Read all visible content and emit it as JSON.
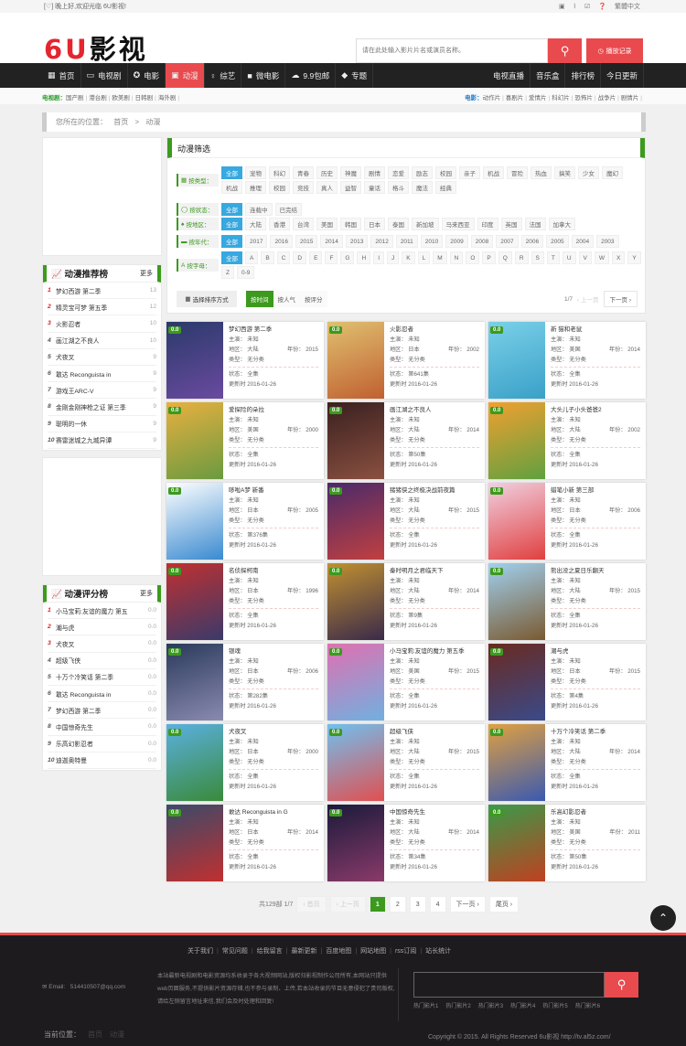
{
  "topbar": {
    "welcome": "[♡] 晚上好,欢迎光临 6U影视!",
    "tools": [
      "▣",
      "⌇",
      "☑",
      "❓"
    ],
    "lang": "繁體中文"
  },
  "logo": {
    "red": "6U",
    "black": "影视"
  },
  "search": {
    "placeholder": "请在此处输入影片片名或演员名称。",
    "button_icon": "search-icon"
  },
  "history_label": "播放记录",
  "nav": {
    "left": [
      {
        "icon": "▦",
        "label": "首页"
      },
      {
        "icon": "▭",
        "label": "电视剧"
      },
      {
        "icon": "✪",
        "label": "电影"
      },
      {
        "icon": "▣",
        "label": "动漫",
        "active": true
      },
      {
        "icon": "♀",
        "label": "综艺"
      },
      {
        "icon": "■",
        "label": "微电影"
      },
      {
        "icon": "☁",
        "label": "9.9包邮"
      },
      {
        "icon": "◆",
        "label": "专题"
      }
    ],
    "right": [
      "电视直播",
      "音乐盒",
      "排行榜",
      "今日更新"
    ]
  },
  "subnav": {
    "left_label": "电视剧：",
    "left_items": [
      "国产剧",
      "港台剧",
      "欧美剧",
      "日韩剧",
      "海外剧"
    ],
    "right_label": "电影：",
    "right_items": [
      "动作片",
      "喜剧片",
      "爱情片",
      "科幻片",
      "恐怖片",
      "战争片",
      "剧情片"
    ]
  },
  "breadcrumb": {
    "label": "您所在的位置：",
    "home": "首页",
    "sep": ">",
    "current": "动漫"
  },
  "recommend": {
    "title": "动漫推荐榜",
    "more": "更多",
    "items": [
      {
        "n": "1",
        "name": "梦幻西游 第二季",
        "v": "13"
      },
      {
        "n": "2",
        "name": "精灵宝可梦 第五季",
        "v": "12"
      },
      {
        "n": "3",
        "name": "火影忍者",
        "v": "10"
      },
      {
        "n": "4",
        "name": "画江湖之不良人",
        "v": "10"
      },
      {
        "n": "5",
        "name": "犬夜叉",
        "v": "9"
      },
      {
        "n": "6",
        "name": "敢达 Reconguista in",
        "v": "9"
      },
      {
        "n": "7",
        "name": "游戏王ARC-V",
        "v": "9"
      },
      {
        "n": "8",
        "name": "金刚金刚神枪之证 第三季",
        "v": "9"
      },
      {
        "n": "9",
        "name": "聪明的一休",
        "v": "9"
      },
      {
        "n": "10",
        "name": "赛雷迷城之九城异谭",
        "v": "9"
      }
    ]
  },
  "score": {
    "title": "动漫评分榜",
    "more": "更多",
    "items": [
      {
        "n": "1",
        "name": "小马宝莉:友谊的魔力 第五",
        "v": "0.0"
      },
      {
        "n": "2",
        "name": "潮与虎",
        "v": "0.0"
      },
      {
        "n": "3",
        "name": "犬夜叉",
        "v": "0.0"
      },
      {
        "n": "4",
        "name": "超级飞侠",
        "v": "0.0"
      },
      {
        "n": "5",
        "name": "十万个冷笑话 第二季",
        "v": "0.0"
      },
      {
        "n": "6",
        "name": "敢达 Reconguista in",
        "v": "0.0"
      },
      {
        "n": "7",
        "name": "梦幻西游 第二季",
        "v": "0.0"
      },
      {
        "n": "8",
        "name": "中国惊奇先生",
        "v": "0.0"
      },
      {
        "n": "9",
        "name": "乐高幻影忍者",
        "v": "0.0"
      },
      {
        "n": "10",
        "name": "迪迦奥特曼",
        "v": "0.0"
      }
    ]
  },
  "filter": {
    "title": "动漫筛选",
    "rows": [
      {
        "icon": "▦",
        "label": "按类型：",
        "opts": [
          "全部",
          "宠物",
          "科幻",
          "青春",
          "历史",
          "神魔",
          "剧情",
          "恋爱",
          "励志",
          "校园",
          "亲子",
          "机战",
          "冒险",
          "热血",
          "搞笑",
          "少女",
          "魔幻",
          "机战",
          "推理",
          "校园",
          "竞技",
          "真人",
          "益智",
          "童话",
          "格斗",
          "魔法",
          "经典"
        ]
      },
      {
        "icon": "◯",
        "label": "按状态：",
        "opts": [
          "全部",
          "连载中",
          "已完结"
        ]
      },
      {
        "icon": "♠",
        "label": "按地区：",
        "opts": [
          "全部",
          "大陆",
          "香港",
          "台湾",
          "美国",
          "韩国",
          "日本",
          "泰国",
          "新加坡",
          "马来西亚",
          "印度",
          "英国",
          "法国",
          "加拿大"
        ]
      },
      {
        "icon": "▬",
        "label": "按年代：",
        "opts": [
          "全部",
          "2017",
          "2016",
          "2015",
          "2014",
          "2013",
          "2012",
          "2011",
          "2010",
          "2009",
          "2008",
          "2007",
          "2006",
          "2005",
          "2004",
          "2003"
        ]
      },
      {
        "icon": "A",
        "label": "按字母：",
        "opts": [
          "全部",
          "A",
          "B",
          "C",
          "D",
          "E",
          "F",
          "G",
          "H",
          "I",
          "J",
          "K",
          "L",
          "M",
          "N",
          "O",
          "P",
          "Q",
          "R",
          "S",
          "T",
          "U",
          "V",
          "W",
          "X",
          "Y",
          "Z",
          "0-9"
        ]
      }
    ],
    "sort_label": "选择排序方式",
    "sort_opts": [
      "按时间",
      "按人气",
      "按评分"
    ],
    "page": "1/7",
    "prev": "‹ 上一页",
    "next": "下一页 ›"
  },
  "labels": {
    "actor": "主演：",
    "area": "地区：",
    "year": "年份：",
    "type": "类型：",
    "status": "状态：",
    "updated": "更新时"
  },
  "cards": [
    {
      "title": "梦幻西游 第二季",
      "score": "0.0",
      "actor": "未知",
      "area": "大陆",
      "year": "2015",
      "type": "无分类",
      "status": "全集",
      "date": "2016-01-26",
      "c1": "#2a3a6a",
      "c2": "#6a4aa0"
    },
    {
      "title": "火影忍者",
      "score": "0.0",
      "actor": "未知",
      "area": "日本",
      "year": "2002",
      "type": "无分类",
      "status": "第641集",
      "date": "2016-01-26",
      "c1": "#e0c070",
      "c2": "#c06030"
    },
    {
      "title": "新 猫和老鼠",
      "score": "0.0",
      "actor": "未知",
      "area": "美国",
      "year": "2014",
      "type": "无分类",
      "status": "全集",
      "date": "2016-01-26",
      "c1": "#7ad0e8",
      "c2": "#3aa0c8"
    },
    {
      "title": "爱探险的朵拉",
      "score": "0.0",
      "actor": "未知",
      "area": "美国",
      "year": "2000",
      "type": "无分类",
      "status": "全集",
      "date": "2016-01-26",
      "c1": "#e8b040",
      "c2": "#6a9a40"
    },
    {
      "title": "画江湖之不良人",
      "score": "0.0",
      "actor": "未知",
      "area": "大陆",
      "year": "2014",
      "type": "无分类",
      "status": "第50集",
      "date": "2016-01-26",
      "c1": "#3a2020",
      "c2": "#8a5040"
    },
    {
      "title": "大头儿子小头爸爸2",
      "score": "0.0",
      "actor": "未知",
      "area": "大陆",
      "year": "2002",
      "type": "无分类",
      "status": "全集",
      "date": "2016-01-26",
      "c1": "#f0a030",
      "c2": "#60a040"
    },
    {
      "title": "哆啦A梦 新番",
      "score": "0.0",
      "actor": "未知",
      "area": "日本",
      "year": "2005",
      "type": "无分类",
      "status": "第376集",
      "date": "2016-01-26",
      "c1": "#ffffff",
      "c2": "#3a8ad0"
    },
    {
      "title": "猪猪侠之终极决战前夜篇",
      "score": "0.0",
      "actor": "未知",
      "area": "大陆",
      "year": "2015",
      "type": "无分类",
      "status": "全集",
      "date": "2016-01-26",
      "c1": "#4a2a6a",
      "c2": "#c04040"
    },
    {
      "title": "蜡笔小新 第三部",
      "score": "0.0",
      "actor": "未知",
      "area": "日本",
      "year": "2006",
      "type": "无分类",
      "status": "全集",
      "date": "2016-01-26",
      "c1": "#f0d0e0",
      "c2": "#e04040"
    },
    {
      "title": "名侦探柯南",
      "score": "0.0",
      "actor": "未知",
      "area": "日本",
      "year": "1996",
      "type": "无分类",
      "status": "全集",
      "date": "2016-01-26",
      "c1": "#c03030",
      "c2": "#3a3a6a"
    },
    {
      "title": "秦时明月之君临天下",
      "score": "0.0",
      "actor": "未知",
      "area": "大陆",
      "year": "2014",
      "type": "无分类",
      "status": "第9集",
      "date": "2016-01-26",
      "c1": "#c09030",
      "c2": "#3a2a4a"
    },
    {
      "title": "熊出没之夏日乐翻天",
      "score": "0.0",
      "actor": "未知",
      "area": "大陆",
      "year": "2015",
      "type": "无分类",
      "status": "全集",
      "date": "2016-01-26",
      "c1": "#a0d0f0",
      "c2": "#7a5a30"
    },
    {
      "title": "银魂",
      "score": "0.0",
      "actor": "未知",
      "area": "日本",
      "year": "2006",
      "type": "无分类",
      "status": "第282集",
      "date": "2016-01-26",
      "c1": "#2a3a5a",
      "c2": "#8a8ab0"
    },
    {
      "title": "小马宝莉:友谊的魔力 第五季",
      "score": "0.0",
      "actor": "未知",
      "area": "美国",
      "year": "2015",
      "type": "无分类",
      "status": "全集",
      "date": "2016-01-26",
      "c1": "#e070b0",
      "c2": "#70b0e0"
    },
    {
      "title": "潮与虎",
      "score": "0.0",
      "actor": "未知",
      "area": "日本",
      "year": "2015",
      "type": "无分类",
      "status": "第4集",
      "date": "2016-01-26",
      "c1": "#6a2a20",
      "c2": "#3a4a8a"
    },
    {
      "title": "犬夜叉",
      "score": "0.0",
      "actor": "未知",
      "area": "日本",
      "year": "2000",
      "type": "无分类",
      "status": "全集",
      "date": "2016-01-26",
      "c1": "#5ab0e0",
      "c2": "#3a8a3a"
    },
    {
      "title": "超级飞侠",
      "score": "0.0",
      "actor": "未知",
      "area": "大陆",
      "year": "2015",
      "type": "无分类",
      "status": "全集",
      "date": "2016-01-26",
      "c1": "#70c0f0",
      "c2": "#e05050"
    },
    {
      "title": "十万个冷笑话 第二季",
      "score": "0.0",
      "actor": "未知",
      "area": "大陆",
      "year": "2014",
      "type": "无分类",
      "status": "全集",
      "date": "2016-01-26",
      "c1": "#e0a040",
      "c2": "#3a5ab0"
    },
    {
      "title": "敢达 Reconguista in G",
      "score": "0.0",
      "actor": "未知",
      "area": "日本",
      "year": "2014",
      "type": "无分类",
      "status": "全集",
      "date": "2016-01-26",
      "c1": "#3a4a6a",
      "c2": "#c03030"
    },
    {
      "title": "中国惊奇先生",
      "score": "0.0",
      "actor": "未知",
      "area": "大陆",
      "year": "2014",
      "type": "无分类",
      "status": "第34集",
      "date": "2016-01-26",
      "c1": "#1a1a3a",
      "c2": "#8a3a6a"
    },
    {
      "title": "乐高幻影忍者",
      "score": "0.0",
      "actor": "未知",
      "area": "美国",
      "year": "2011",
      "type": "无分类",
      "status": "第50集",
      "date": "2016-01-26",
      "c1": "#3a9a4a",
      "c2": "#c04020"
    }
  ],
  "pager": {
    "total": "共129部 1/7",
    "first": "‹ 首页",
    "prev": "‹ 上一页",
    "pages": [
      "1",
      "2",
      "3",
      "4"
    ],
    "next": "下一页 ›",
    "last": "尾页 ›"
  },
  "footer": {
    "links": [
      "关于我们",
      "常见问题",
      "给我留言",
      "最新更新",
      "百度地图",
      "网站地图",
      "rss订阅",
      "站长统计"
    ],
    "email_label": "✉ Email:",
    "email": "514410507@qq.com",
    "desc": "本站最新电视剧和电影资源均系收录于各大视频网站,版权归影视制作公司所有,本网站只提供web页面服务,不提供影片资源存储,也不参与录制、上传,若本站收录的节目无意侵犯了贵司版权,请给左侧留言地址来信,我们会及时处理和回复!",
    "hot": [
      "热门影片1",
      "热门影片2",
      "热门影片3",
      "热门影片4",
      "热门影片5",
      "热门影片6"
    ],
    "pos_label": "当前位置：",
    "pos_home": "首页",
    "pos_cur": "动漫",
    "copyright": "Copyright © 2015. All Rights Reserved 6u影视 http://tv.al5z.com/"
  }
}
